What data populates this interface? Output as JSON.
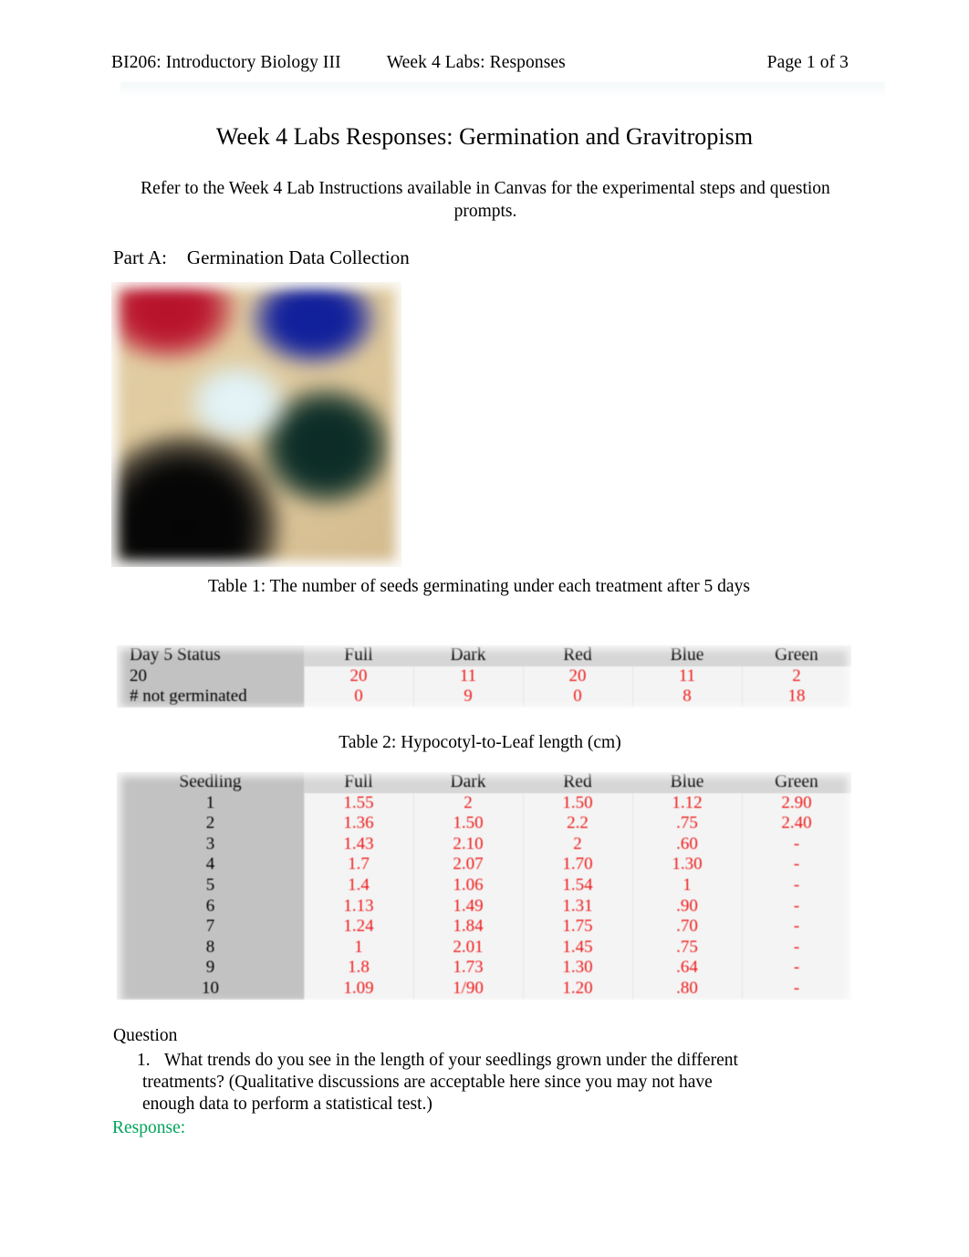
{
  "header": {
    "course": "BI206: Introductory Biology III",
    "middle": "Week 4 Labs: Responses",
    "page": "Page 1 of 3"
  },
  "title": "Week 4 Labs Responses: Germination and Gravitropism",
  "subtitle": "Refer to the Week 4 Lab Instructions available in Canvas for the experimental steps and question prompts.",
  "part_a": {
    "label": "Part A:",
    "text": "Germination Data Collection"
  },
  "photo": {
    "alt_name": "germination-setup-photo",
    "colors": {
      "red_cup": "#bb1730",
      "blue_cup": "#13219c",
      "green_square": "#0e2f28",
      "black_cup": "#070707",
      "white_object": "#e4f2f6",
      "background": "#e0cb9f"
    }
  },
  "table1": {
    "caption": "Table 1: The number of seeds germinating under each treatment after 5 days",
    "headers": [
      "Day 5 Status",
      "Full",
      "Dark",
      "Red",
      "Blue",
      "Green"
    ],
    "rows": [
      {
        "label": "20",
        "values": [
          "20",
          "11",
          "20",
          "11",
          "2"
        ]
      },
      {
        "label": "# not germinated",
        "values": [
          "0",
          "9",
          "0",
          "8",
          "18"
        ]
      }
    ]
  },
  "table2": {
    "caption": "Table 2: Hypocotyl-to-Leaf length (cm)",
    "headers": [
      "Seedling",
      "Full",
      "Dark",
      "Red",
      "Blue",
      "Green"
    ],
    "rows": [
      {
        "label": "1",
        "values": [
          "1.55",
          "2",
          "1.50",
          "1.12",
          "2.90"
        ]
      },
      {
        "label": "2",
        "values": [
          "1.36",
          "1.50",
          "2.2",
          ".75",
          "2.40"
        ]
      },
      {
        "label": "3",
        "values": [
          "1.43",
          "2.10",
          "2",
          ".60",
          "-"
        ]
      },
      {
        "label": "4",
        "values": [
          "1.7",
          "2.07",
          "1.70",
          "1.30",
          "-"
        ]
      },
      {
        "label": "5",
        "values": [
          "1.4",
          "1.06",
          "1.54",
          "1",
          "-"
        ]
      },
      {
        "label": "6",
        "values": [
          "1.13",
          "1.49",
          "1.31",
          ".90",
          "-"
        ]
      },
      {
        "label": "7",
        "values": [
          "1.24",
          "1.84",
          "1.75",
          ".70",
          "-"
        ]
      },
      {
        "label": "8",
        "values": [
          "1",
          "2.01",
          "1.45",
          ".75",
          "-"
        ]
      },
      {
        "label": "9",
        "values": [
          "1.8",
          "1.73",
          "1.30",
          ".64",
          "-"
        ]
      },
      {
        "label": "10",
        "values": [
          "1.09",
          "1/90",
          "1.20",
          ".80",
          "-"
        ]
      }
    ]
  },
  "question_section": {
    "heading": "Question",
    "number": "1.",
    "text": "What trends do you see in the length of your seedlings grown under the different treatments? (Qualitative discussions are acceptable here since you may not have enough data to perform a statistical test.)",
    "response_label": "Response:"
  },
  "colors": {
    "data_red": "#ef1a1a",
    "response_green": "#00a45a",
    "label_column_gray": "#c2c2c2",
    "header_row_gray": "#d6d6d6",
    "value_cell_gray": "#f4f4f4"
  }
}
